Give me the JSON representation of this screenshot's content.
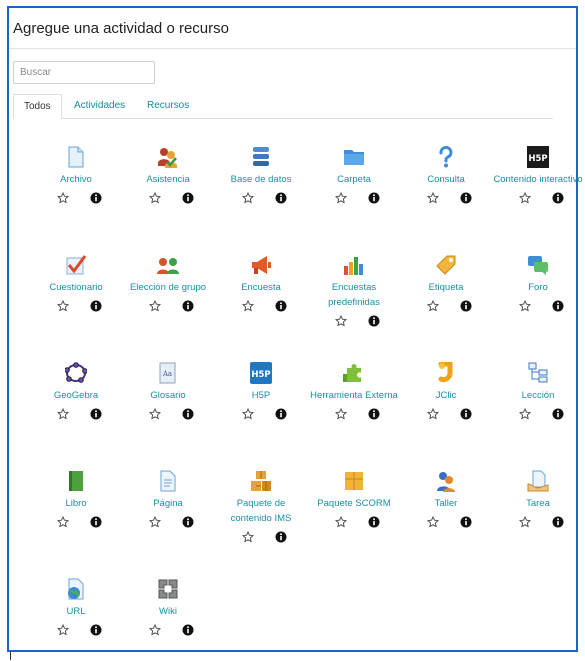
{
  "title": "Agregue una actividad o recurso",
  "search": {
    "placeholder": "Buscar"
  },
  "tabs": [
    "Todos",
    "Actividades",
    "Recursos"
  ],
  "items": [
    {
      "label": "Archivo",
      "icon": "file-icon"
    },
    {
      "label": "Asistencia",
      "icon": "attendance-icon"
    },
    {
      "label": "Base de datos",
      "icon": "database-icon"
    },
    {
      "label": "Carpeta",
      "icon": "folder-icon"
    },
    {
      "label": "Consulta",
      "icon": "question-icon"
    },
    {
      "label": "Contenido interactivo",
      "icon": "h5p-black-icon"
    },
    {
      "label": "Cuestionario",
      "icon": "quiz-icon"
    },
    {
      "label": "Elección de grupo",
      "icon": "group-choice-icon"
    },
    {
      "label": "Encuesta",
      "icon": "megaphone-icon"
    },
    {
      "label": "Encuestas predefinidas",
      "icon": "bar-chart-icon"
    },
    {
      "label": "Etiqueta",
      "icon": "tag-icon"
    },
    {
      "label": "Foro",
      "icon": "forum-icon"
    },
    {
      "label": "GeoGebra",
      "icon": "geogebra-icon"
    },
    {
      "label": "Glosario",
      "icon": "glossary-icon"
    },
    {
      "label": "H5P",
      "icon": "h5p-blue-icon"
    },
    {
      "label": "Herramienta Externa",
      "icon": "puzzle-icon"
    },
    {
      "label": "JClic",
      "icon": "jclic-icon"
    },
    {
      "label": "Lección",
      "icon": "lesson-icon"
    },
    {
      "label": "Libro",
      "icon": "book-icon"
    },
    {
      "label": "Página",
      "icon": "page-icon"
    },
    {
      "label": "Paquete de contenido IMS",
      "icon": "ims-package-icon"
    },
    {
      "label": "Paquete SCORM",
      "icon": "scorm-package-icon"
    },
    {
      "label": "Taller",
      "icon": "workshop-icon"
    },
    {
      "label": "Tarea",
      "icon": "assignment-icon"
    },
    {
      "label": "URL",
      "icon": "url-globe-icon"
    },
    {
      "label": "Wiki",
      "icon": "wiki-icon"
    }
  ],
  "colors": {
    "frame": "#1a66c2",
    "link": "#1a8fa3",
    "tab_link": "#1a8a9a"
  }
}
